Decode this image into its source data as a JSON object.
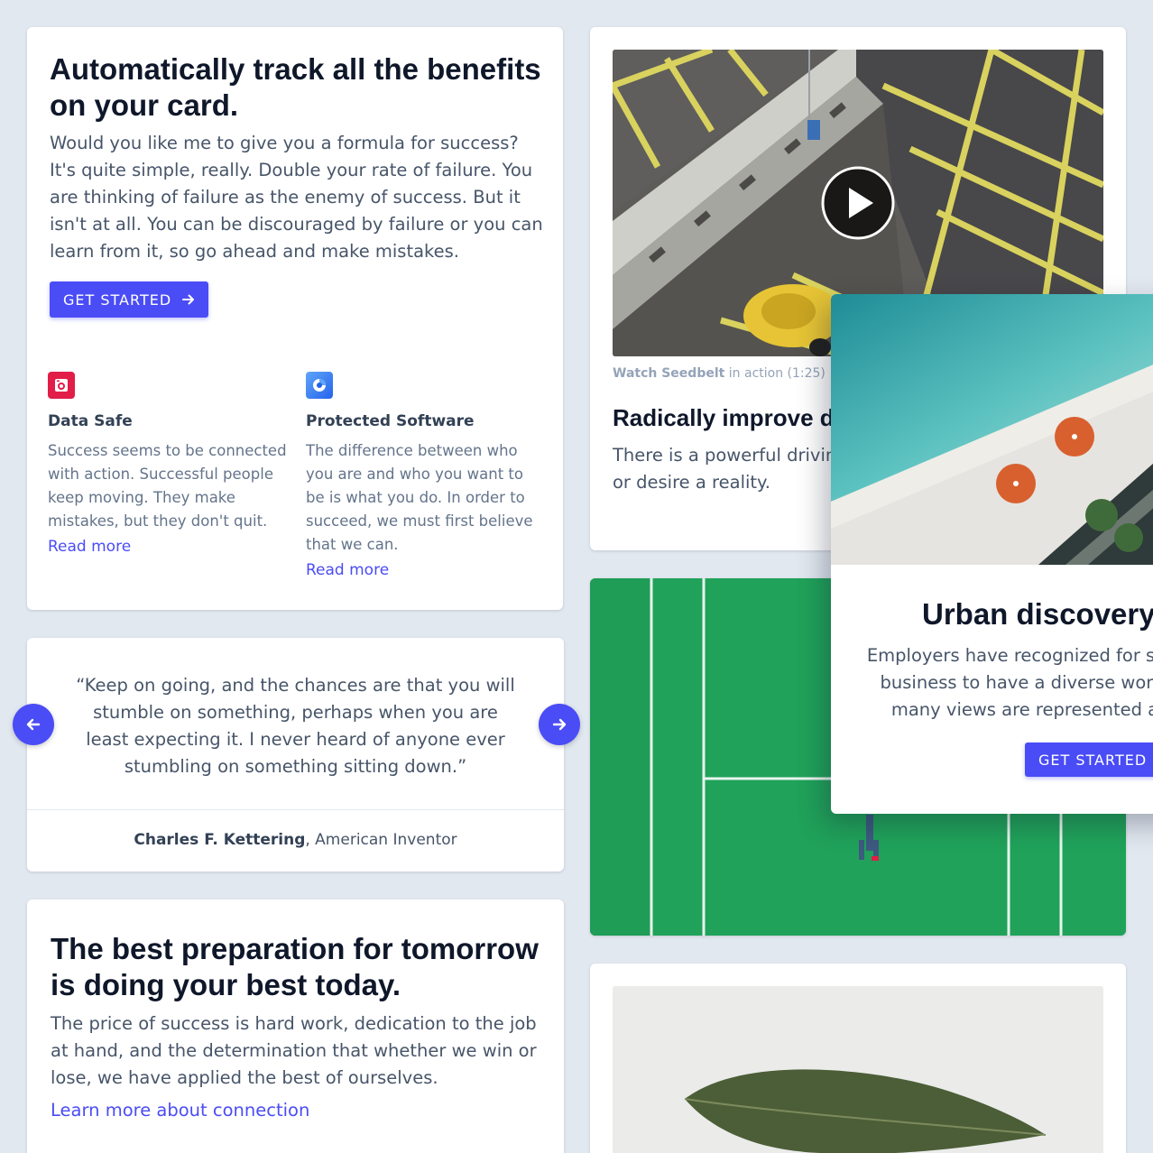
{
  "feature_card": {
    "title": "Automatically track all the benefits on your card.",
    "lead": "Would you like me to give you a formula for success? It's quite simple, really. Double your rate of failure. You are thinking of failure as the enemy of success. But it isn't at all. You can be discouraged by failure or you can learn from it, so go ahead and make mistakes.",
    "button_label": "GET STARTED",
    "features": [
      {
        "icon": "safe-icon",
        "title": "Data Safe",
        "text": "Success seems to be connected with action. Successful people keep moving. They make mistakes, but they don't quit.",
        "link": "Read more"
      },
      {
        "icon": "shield-icon",
        "title": "Protected Software",
        "text": "The difference between who you are and who you want to be is what you do. In order to succeed, we must first believe that we can.",
        "link": "Read more"
      }
    ]
  },
  "testimonial": {
    "quote": "“Keep on going, and the chances are that you will stumble on something, perhaps when you are least expecting it. I never heard of anyone ever stumbling on something sitting down.”",
    "author": "Charles F. Kettering",
    "role": ", American Inventor"
  },
  "preparation_card": {
    "title": "The best preparation for tomorrow is doing your best today.",
    "lead": "The price of success is hard work, dedication to the job at hand, and the determination that whether we win or lose, we have applied the best of ourselves.",
    "link": "Learn more about connection"
  },
  "video_card": {
    "caption_bold": "Watch Seedbelt",
    "caption_rest": " in action (1:25)",
    "title": "Radically improve de",
    "lead": "There is a powerful driving being that, once unleashe or desire a reality."
  },
  "overlay_card": {
    "title": "Urban discovery c",
    "lead_lines": [
      "Employers have recognized for som",
      "business to have a diverse workf",
      "many views are represented a"
    ],
    "button_label": "GET STARTED"
  },
  "colors": {
    "accent": "#4a4cf6",
    "background": "#e2e8f0",
    "court_green": "#20a25a"
  }
}
